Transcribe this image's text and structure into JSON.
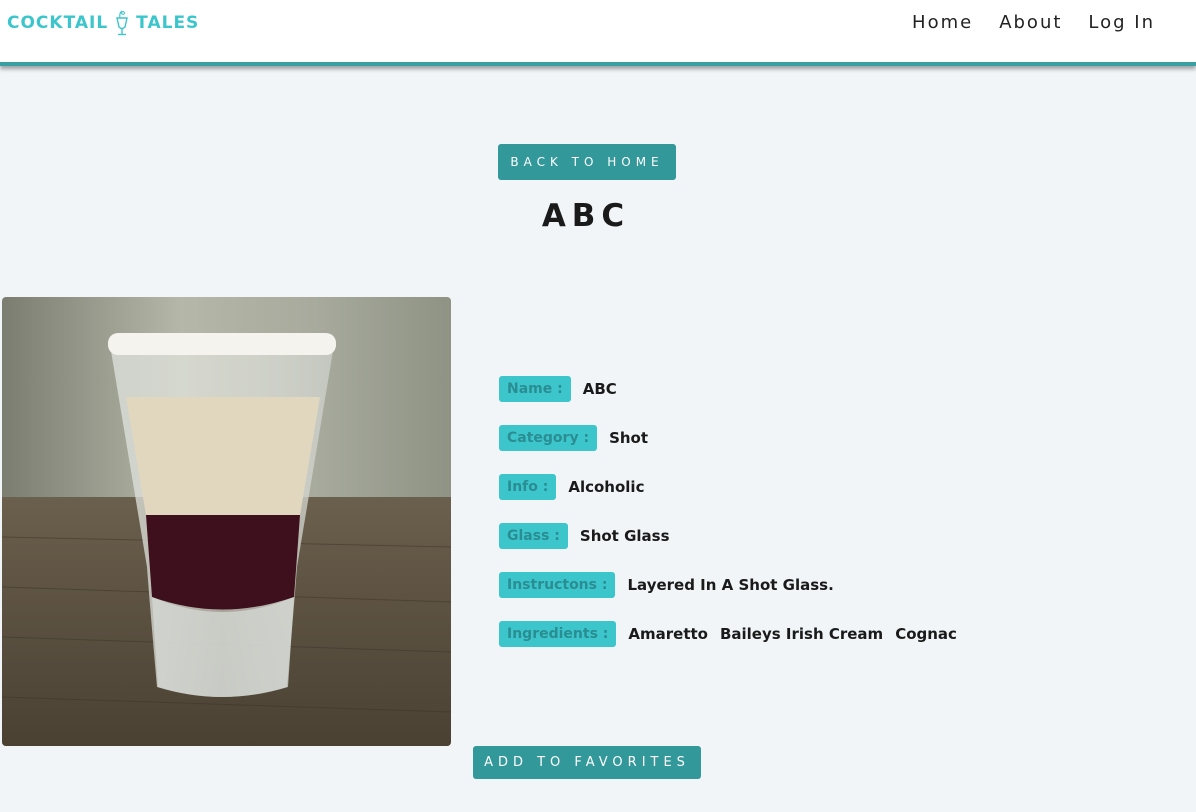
{
  "brand": {
    "name_left": "COCKTAIL",
    "name_right": "TALES",
    "icon": "cocktail-glass-icon",
    "color": "#3cc6cc"
  },
  "nav": {
    "items": [
      {
        "label": "Home"
      },
      {
        "label": "About"
      },
      {
        "label": "Log In"
      }
    ]
  },
  "buttons": {
    "back": "BACK TO HOME",
    "favorite": "ADD TO FAVORITES",
    "color": "#33989a"
  },
  "drink": {
    "title": "ABC",
    "image_alt": "layered-shot-glass-photo",
    "fields": [
      {
        "label": "Name :",
        "value": "ABC"
      },
      {
        "label": "Category :",
        "value": "Shot"
      },
      {
        "label": "Info :",
        "value": "Alcoholic"
      },
      {
        "label": "Glass :",
        "value": "Shot Glass"
      },
      {
        "label": "Instructons :",
        "value": "Layered In A Shot Glass."
      }
    ],
    "ingredients_label": "Ingredients :",
    "ingredients": [
      "Amaretto",
      "Baileys Irish Cream",
      "Cognac"
    ]
  }
}
